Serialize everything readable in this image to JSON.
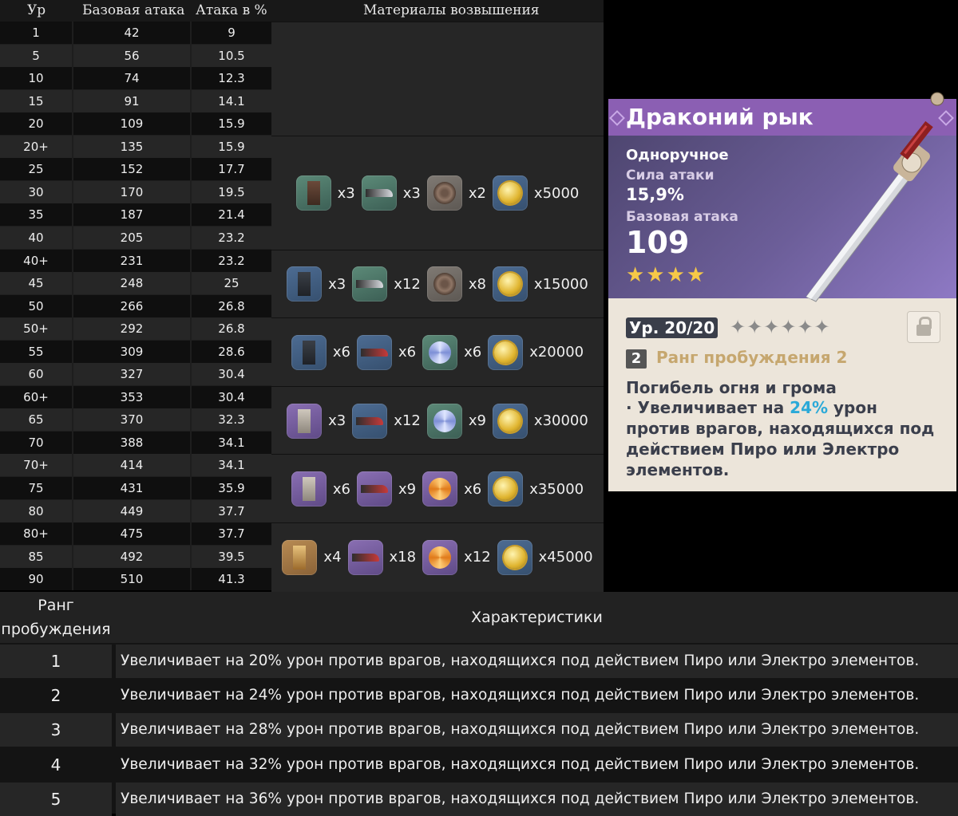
{
  "stats_table": {
    "headers": [
      "Ур",
      "Базовая атака",
      "Атака в %",
      "Материалы возвышения"
    ],
    "rows": [
      {
        "level": "1",
        "base_atk": "42",
        "atk_pct": "9"
      },
      {
        "level": "5",
        "base_atk": "56",
        "atk_pct": "10.5"
      },
      {
        "level": "10",
        "base_atk": "74",
        "atk_pct": "12.3"
      },
      {
        "level": "15",
        "base_atk": "91",
        "atk_pct": "14.1"
      },
      {
        "level": "20",
        "base_atk": "109",
        "atk_pct": "15.9"
      },
      {
        "level": "20+",
        "base_atk": "135",
        "atk_pct": "15.9"
      },
      {
        "level": "25",
        "base_atk": "152",
        "atk_pct": "17.7"
      },
      {
        "level": "30",
        "base_atk": "170",
        "atk_pct": "19.5"
      },
      {
        "level": "35",
        "base_atk": "187",
        "atk_pct": "21.4"
      },
      {
        "level": "40",
        "base_atk": "205",
        "atk_pct": "23.2"
      },
      {
        "level": "40+",
        "base_atk": "231",
        "atk_pct": "23.2"
      },
      {
        "level": "45",
        "base_atk": "248",
        "atk_pct": "25"
      },
      {
        "level": "50",
        "base_atk": "266",
        "atk_pct": "26.8"
      },
      {
        "level": "50+",
        "base_atk": "292",
        "atk_pct": "26.8"
      },
      {
        "level": "55",
        "base_atk": "309",
        "atk_pct": "28.6"
      },
      {
        "level": "60",
        "base_atk": "327",
        "atk_pct": "30.4"
      },
      {
        "level": "60+",
        "base_atk": "353",
        "atk_pct": "30.4"
      },
      {
        "level": "65",
        "base_atk": "370",
        "atk_pct": "32.3"
      },
      {
        "level": "70",
        "base_atk": "388",
        "atk_pct": "34.1"
      },
      {
        "level": "70+",
        "base_atk": "414",
        "atk_pct": "34.1"
      },
      {
        "level": "75",
        "base_atk": "431",
        "atk_pct": "35.9"
      },
      {
        "level": "80",
        "base_atk": "449",
        "atk_pct": "37.7"
      },
      {
        "level": "80+",
        "base_atk": "475",
        "atk_pct": "37.7"
      },
      {
        "level": "85",
        "base_atk": "492",
        "atk_pct": "39.5"
      },
      {
        "level": "90",
        "base_atk": "510",
        "atk_pct": "41.3"
      }
    ],
    "ascension": [
      {
        "items": [
          {
            "icon": "brown-slab-icon",
            "qty": "x3"
          },
          {
            "icon": "dark-blade-icon",
            "qty": "x3"
          },
          {
            "icon": "bronze-disc-icon",
            "qty": "x2"
          },
          {
            "icon": "mora-coin-icon",
            "qty": "x5000"
          }
        ]
      },
      {
        "items": [
          {
            "icon": "dark-slab-icon",
            "qty": "x3"
          },
          {
            "icon": "dark-blade-icon",
            "qty": "x12"
          },
          {
            "icon": "bronze-disc-icon",
            "qty": "x8"
          },
          {
            "icon": "mora-coin-icon",
            "qty": "x15000"
          }
        ]
      },
      {
        "items": [
          {
            "icon": "dark-slab-icon",
            "qty": "x6"
          },
          {
            "icon": "red-blade-icon",
            "qty": "x6"
          },
          {
            "icon": "silver-swirl-icon",
            "qty": "x6"
          },
          {
            "icon": "mora-coin-icon",
            "qty": "x20000"
          }
        ]
      },
      {
        "items": [
          {
            "icon": "stone-slab-icon",
            "qty": "x3"
          },
          {
            "icon": "red-blade-icon",
            "qty": "x12"
          },
          {
            "icon": "silver-swirl-icon",
            "qty": "x9"
          },
          {
            "icon": "mora-coin-icon",
            "qty": "x30000"
          }
        ]
      },
      {
        "items": [
          {
            "icon": "stone-slab-icon",
            "qty": "x6"
          },
          {
            "icon": "crimson-blade-icon",
            "qty": "x9"
          },
          {
            "icon": "orange-swirl-icon",
            "qty": "x6"
          },
          {
            "icon": "mora-coin-icon",
            "qty": "x35000"
          }
        ]
      },
      {
        "items": [
          {
            "icon": "gold-slab-icon",
            "qty": "x4"
          },
          {
            "icon": "crimson-blade-icon",
            "qty": "x18"
          },
          {
            "icon": "orange-swirl-icon",
            "qty": "x12"
          },
          {
            "icon": "mora-coin-icon",
            "qty": "x45000"
          }
        ]
      }
    ]
  },
  "weapon_card": {
    "name": "Драконий рык",
    "type": "Одноручное",
    "secondary_stat_label": "Сила атаки",
    "secondary_stat_value": "15,9%",
    "base_atk_label": "Базовая атака",
    "base_atk_value": "109",
    "rarity_stars": "★★★★",
    "level_text": "Ур. 20/20",
    "ascension_stars": "✦✦✦✦✦✦",
    "refinement_number": "2",
    "refinement_label": "Ранг пробуждения 2",
    "passive_name": "Погибель огня и грома",
    "passive_desc_prefix": "· Увеличивает на ",
    "passive_desc_highlight": "24%",
    "passive_desc_suffix": " урон против врагов, находящихся под действием Пиро или Электро элементов.",
    "colors": {
      "title_bg": "#8b5fb3",
      "star": "#f6c947",
      "highlight": "#2aa9d8",
      "refine_label": "#c6a76f"
    }
  },
  "refinement_table": {
    "header_rank": "Ранг пробуждения",
    "header_stats": "Характеристики",
    "rows": [
      {
        "rank": "1",
        "text": "Увеличивает на 20% урон против врагов, находящихся под действием Пиро или Электро элементов."
      },
      {
        "rank": "2",
        "text": "Увеличивает на 24% урон против врагов, находящихся под действием Пиро или Электро элементов."
      },
      {
        "rank": "3",
        "text": "Увеличивает на 28% урон против врагов, находящихся под действием Пиро или Электро элементов."
      },
      {
        "rank": "4",
        "text": "Увеличивает на 32% урон против врагов, находящихся под действием Пиро или Электро элементов."
      },
      {
        "rank": "5",
        "text": "Увеличивает на 36% урон против врагов, находящихся под действием Пиро или Электро элементов."
      }
    ]
  }
}
